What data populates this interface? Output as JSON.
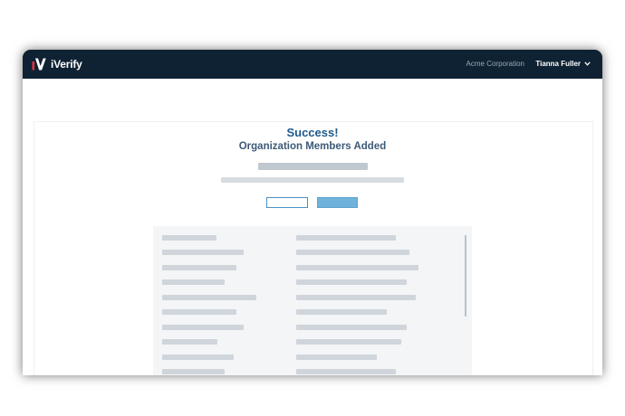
{
  "app": {
    "name": "iVerify",
    "accent": "#1c5a8d",
    "navbar_color": "#0f2233"
  },
  "header": {
    "organization": "Acme Corporation",
    "user_name": "Tianna Fuller",
    "menu_icon": "chevron-down-icon"
  },
  "main": {
    "title": "Success!",
    "subtitle": "Organization Members Added"
  },
  "members_list": {
    "row_count": 12,
    "scrollable": true
  }
}
